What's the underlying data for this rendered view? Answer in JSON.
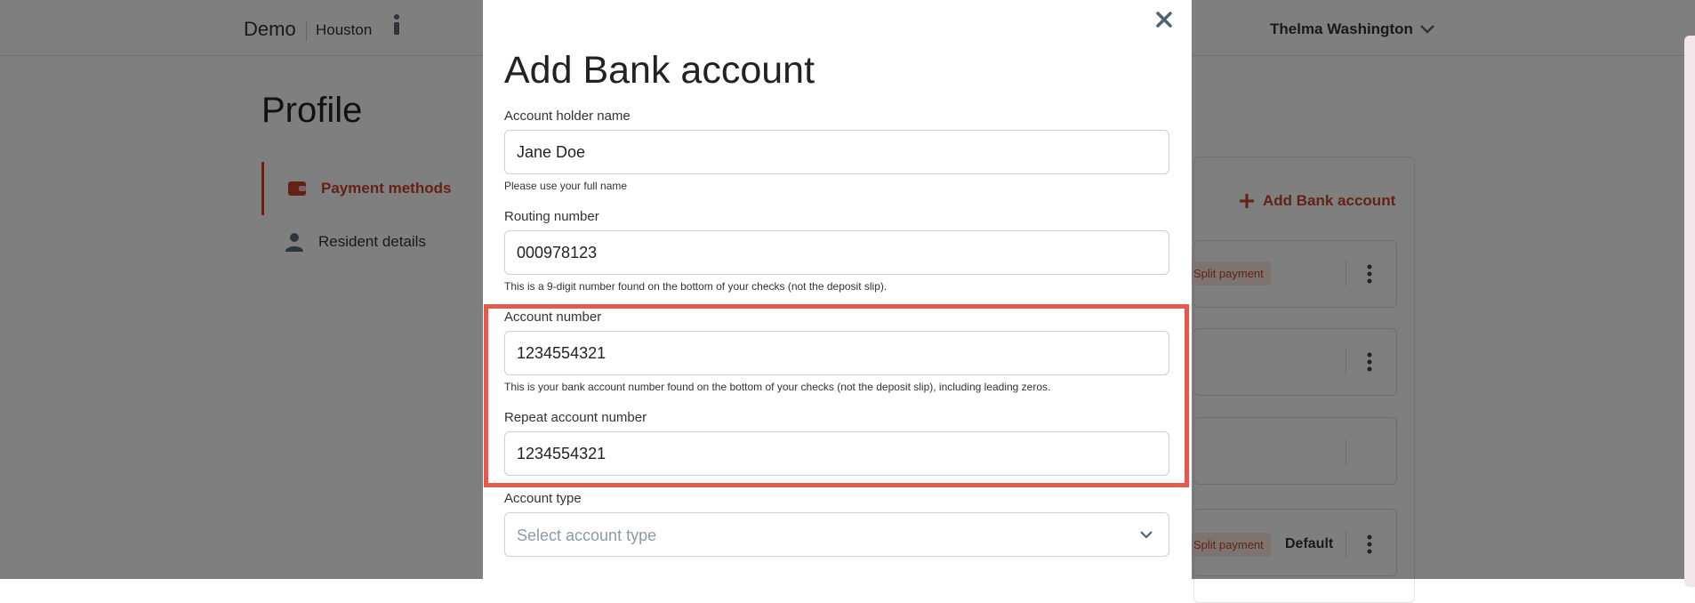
{
  "topbar": {
    "brand": "Demo",
    "city": "Houston",
    "info_icon": "info-icon",
    "user_name": "Thelma Washington",
    "user_menu_icon": "chevron-down-icon"
  },
  "page": {
    "title": "Profile"
  },
  "sidebar": {
    "items": [
      {
        "label": "Payment methods",
        "icon": "wallet-icon",
        "active": true
      },
      {
        "label": "Resident details",
        "icon": "person-icon",
        "active": false
      }
    ]
  },
  "payment_methods": {
    "add_label": "Add Bank account",
    "split_label": "Split payment",
    "default_label": "Default"
  },
  "modal": {
    "title": "Add Bank account",
    "close_icon": "close-icon",
    "fields": {
      "holder": {
        "label": "Account holder name",
        "value": "Jane Doe",
        "help": "Please use your full name"
      },
      "routing": {
        "label": "Routing number",
        "value": "000978123",
        "help": "This is a 9-digit number found on the bottom of your checks (not the deposit slip)."
      },
      "account": {
        "label": "Account number",
        "value": "1234554321",
        "help": "This is your bank account number found on the bottom of your checks (not the deposit slip), including leading zeros."
      },
      "repeat": {
        "label": "Repeat account number",
        "value": "1234554321"
      },
      "type": {
        "label": "Account type",
        "placeholder": "Select account type"
      }
    }
  },
  "colors": {
    "accent": "#c8452c",
    "highlight": "#e55a4f"
  }
}
